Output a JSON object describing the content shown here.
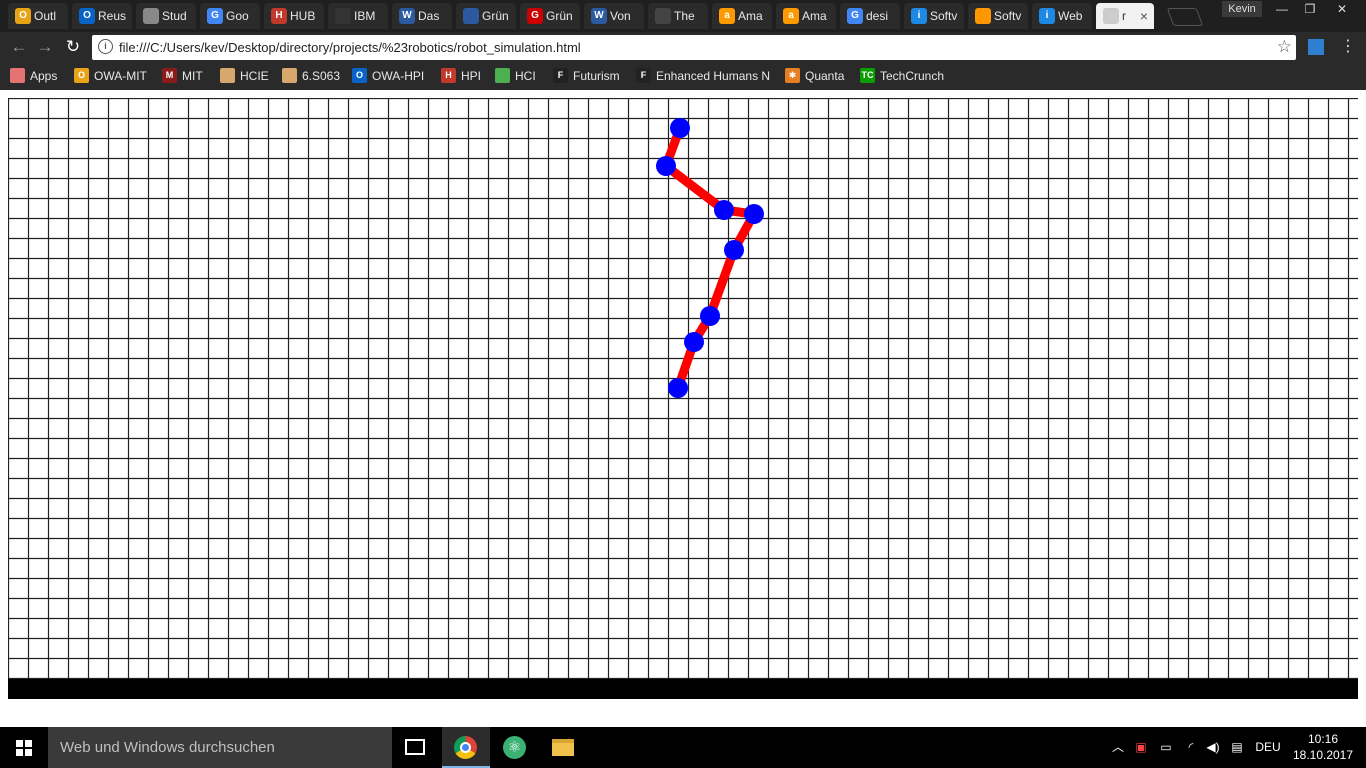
{
  "browser": {
    "tabs": [
      {
        "title": "Outl",
        "color": "#e8a317",
        "glyph": "O"
      },
      {
        "title": "Reus",
        "color": "#0a64c8",
        "glyph": "O"
      },
      {
        "title": "Stud",
        "color": "#888888",
        "glyph": ""
      },
      {
        "title": "Goo",
        "color": "#4285f4",
        "glyph": "G"
      },
      {
        "title": "HUB",
        "color": "#c0392b",
        "glyph": "H"
      },
      {
        "title": "IBM",
        "color": "#333333",
        "glyph": ""
      },
      {
        "title": "Das",
        "color": "#2c5aa0",
        "glyph": "W"
      },
      {
        "title": "Grün",
        "color": "#2c5aa0",
        "glyph": ""
      },
      {
        "title": "Grün",
        "color": "#cc0000",
        "glyph": "G"
      },
      {
        "title": "Von",
        "color": "#2c5aa0",
        "glyph": "W"
      },
      {
        "title": "The",
        "color": "#444444",
        "glyph": ""
      },
      {
        "title": "Ama",
        "color": "#ff9900",
        "glyph": "a"
      },
      {
        "title": "Ama",
        "color": "#ff9900",
        "glyph": "a"
      },
      {
        "title": "desi",
        "color": "#4285f4",
        "glyph": "G"
      },
      {
        "title": "Softv",
        "color": "#1e88e5",
        "glyph": "i"
      },
      {
        "title": "Softv",
        "color": "#ff9800",
        "glyph": ""
      },
      {
        "title": "Web",
        "color": "#1e88e5",
        "glyph": "i"
      },
      {
        "title": "r",
        "color": "#cccccc",
        "glyph": ""
      }
    ],
    "profile_name": "Kevin",
    "url": "file:///C:/Users/kev/Desktop/directory/projects/%23robotics/robot_simulation.html",
    "bookmarks": [
      {
        "label": "Apps",
        "color": "#e57373",
        "glyph": ""
      },
      {
        "label": "OWA-MIT",
        "color": "#e8a317",
        "glyph": "O"
      },
      {
        "label": "MIT",
        "color": "#8b1a1a",
        "glyph": "M"
      },
      {
        "label": "HCIE",
        "color": "#d7a86e",
        "glyph": ""
      },
      {
        "label": "6.S063",
        "color": "#d7a86e",
        "glyph": ""
      },
      {
        "label": "OWA-HPI",
        "color": "#0a64c8",
        "glyph": "O"
      },
      {
        "label": "HPI",
        "color": "#c0392b",
        "glyph": "H"
      },
      {
        "label": "HCI",
        "color": "#4caf50",
        "glyph": ""
      },
      {
        "label": "Futurism",
        "color": "#222222",
        "glyph": "F"
      },
      {
        "label": "Enhanced Humans N",
        "color": "#222222",
        "glyph": "F"
      },
      {
        "label": "Quanta",
        "color": "#e67e22",
        "glyph": "✱"
      },
      {
        "label": "TechCrunch",
        "color": "#0a9e01",
        "glyph": "TC"
      }
    ]
  },
  "simulation": {
    "grid": {
      "line_color": "#222222",
      "background": "#ffffff"
    },
    "arm": {
      "link_color": "#ff0000",
      "joint_color": "#0000ff",
      "joints": [
        {
          "col": 33.6,
          "row": 1.5
        },
        {
          "col": 32.9,
          "row": 3.4
        },
        {
          "col": 35.8,
          "row": 5.6
        },
        {
          "col": 37.3,
          "row": 5.8
        },
        {
          "col": 36.3,
          "row": 7.6
        },
        {
          "col": 35.1,
          "row": 10.9
        },
        {
          "col": 34.3,
          "row": 12.2
        },
        {
          "col": 33.5,
          "row": 14.5
        }
      ]
    }
  },
  "taskbar": {
    "search_placeholder": "Web und Windows durchsuchen",
    "language": "DEU",
    "time": "10:16",
    "date": "18.10.2017"
  }
}
